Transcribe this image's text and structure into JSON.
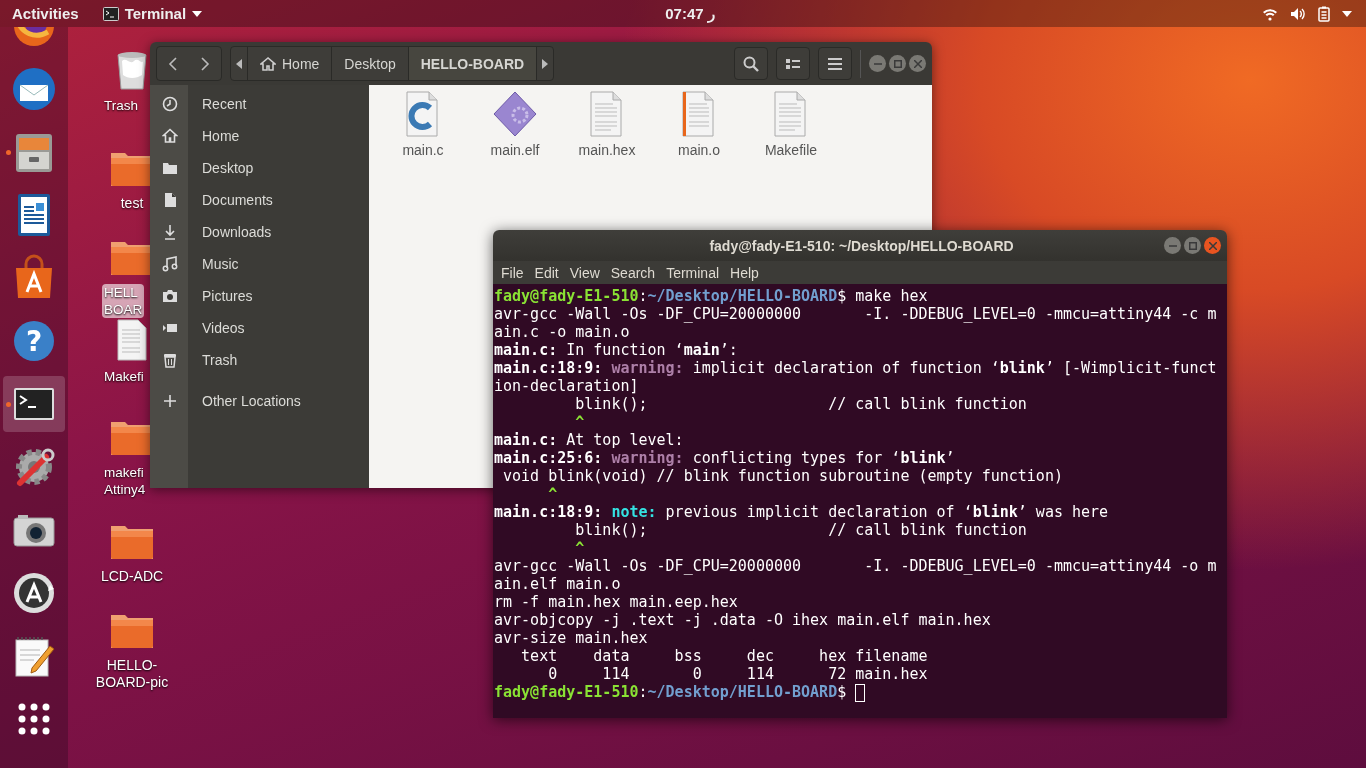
{
  "top_bar": {
    "activities": "Activities",
    "app_menu": "Terminal",
    "clock": "07:47 ر"
  },
  "dock": [
    {
      "kind": "globe",
      "running": false,
      "active": false
    },
    {
      "kind": "mail",
      "running": false,
      "active": false
    },
    {
      "kind": "files",
      "running": true,
      "active": false
    },
    {
      "kind": "writer",
      "running": false,
      "active": false
    },
    {
      "kind": "store",
      "running": false,
      "active": false
    },
    {
      "kind": "help",
      "glyph": "?",
      "running": false,
      "active": false
    },
    {
      "kind": "terminal",
      "running": true,
      "active": true
    },
    {
      "kind": "tools",
      "running": false,
      "active": false
    },
    {
      "kind": "camera",
      "running": false,
      "active": false
    },
    {
      "kind": "updater",
      "running": false,
      "active": false
    },
    {
      "kind": "editor",
      "running": false,
      "active": false
    },
    {
      "kind": "grid",
      "running": false,
      "active": false
    }
  ],
  "desktop_items": [
    {
      "kind": "trash",
      "label_lines": [
        "Trash"
      ],
      "cut": true,
      "selected": false
    },
    {
      "kind": "folder",
      "label_lines": [
        "test"
      ],
      "cut": false,
      "selected": false
    },
    {
      "kind": "folder",
      "label_lines": [
        "HELL",
        "BOAR"
      ],
      "cut": true,
      "selected": true
    },
    {
      "kind": "document",
      "label_lines": [
        "Makefi"
      ],
      "cut": true,
      "selected": false
    },
    {
      "kind": "folder",
      "label_lines": [
        "makefi",
        "Attiny4"
      ],
      "cut": true,
      "selected": false
    },
    {
      "kind": "folder",
      "label_lines": [
        "LCD-ADC"
      ],
      "cut": false,
      "selected": false
    },
    {
      "kind": "folder",
      "label_lines": [
        "HELLO-",
        "BOARD-pic"
      ],
      "cut": false,
      "selected": false
    }
  ],
  "file_manager": {
    "path": [
      {
        "label": "Home",
        "kind": "home",
        "selected": false
      },
      {
        "label": "Desktop",
        "kind": "plain",
        "selected": false
      },
      {
        "label": "HELLO-BOARD",
        "kind": "plain",
        "selected": true
      }
    ],
    "sidebar": [
      {
        "label": "Recent",
        "kind": "clock"
      },
      {
        "label": "Home",
        "kind": "home"
      },
      {
        "label": "Desktop",
        "kind": "folder"
      },
      {
        "label": "Documents",
        "kind": "document"
      },
      {
        "label": "Downloads",
        "kind": "download"
      },
      {
        "label": "Music",
        "kind": "music"
      },
      {
        "label": "Pictures",
        "kind": "camera"
      },
      {
        "label": "Videos",
        "kind": "video"
      },
      {
        "label": "Trash",
        "kind": "trash"
      },
      {
        "label": "Other Locations",
        "kind": "plus"
      }
    ],
    "files": [
      {
        "name": "main.c",
        "kind": "c-source"
      },
      {
        "name": "main.elf",
        "kind": "binary"
      },
      {
        "name": "main.hex",
        "kind": "text"
      },
      {
        "name": "main.o",
        "kind": "object"
      },
      {
        "name": "Makefile",
        "kind": "text"
      }
    ]
  },
  "terminal": {
    "title": "fady@fady-E1-510: ~/Desktop/HELLO-BOARD",
    "menu": [
      "File",
      "Edit",
      "View",
      "Search",
      "Terminal",
      "Help"
    ],
    "cursor": true,
    "lines": [
      [
        {
          "t": "fady@fady-E1-510",
          "kind": "user"
        },
        {
          "t": ":",
          "kind": "plain"
        },
        {
          "t": "~/Desktop/HELLO-BOARD",
          "kind": "path"
        },
        {
          "t": "$ make hex",
          "kind": "plain"
        }
      ],
      [
        {
          "t": "avr-gcc -Wall -Os -DF_CPU=20000000       -I. -DDEBUG_LEVEL=0 -mmcu=attiny44 -c m",
          "kind": "plain"
        }
      ],
      [
        {
          "t": "ain.c -o main.o",
          "kind": "plain"
        }
      ],
      [
        {
          "t": "main.c:",
          "kind": "bold"
        },
        {
          "t": " In function ‘",
          "kind": "plain"
        },
        {
          "t": "main",
          "kind": "bold"
        },
        {
          "t": "’:",
          "kind": "plain"
        }
      ],
      [
        {
          "t": "main.c:18:9: ",
          "kind": "bold"
        },
        {
          "t": "warning:",
          "kind": "warning"
        },
        {
          "t": " implicit declaration of function ‘",
          "kind": "plain"
        },
        {
          "t": "blink",
          "kind": "bold"
        },
        {
          "t": "’ [-Wimplicit-funct",
          "kind": "plain"
        }
      ],
      [
        {
          "t": "ion-declaration]",
          "kind": "plain"
        }
      ],
      [
        {
          "t": "         blink();                    // call blink function",
          "kind": "plain"
        }
      ],
      [
        {
          "t": "         ^",
          "kind": "caret"
        }
      ],
      [
        {
          "t": "main.c:",
          "kind": "bold"
        },
        {
          "t": " At top level:",
          "kind": "plain"
        }
      ],
      [
        {
          "t": "main.c:25:6: ",
          "kind": "bold"
        },
        {
          "t": "warning:",
          "kind": "warning"
        },
        {
          "t": " conflicting types for ‘",
          "kind": "plain"
        },
        {
          "t": "blink",
          "kind": "bold"
        },
        {
          "t": "’",
          "kind": "plain"
        }
      ],
      [
        {
          "t": " void blink(void) // blink function subroutine (empty function)",
          "kind": "plain"
        }
      ],
      [
        {
          "t": "      ^",
          "kind": "caret"
        }
      ],
      [
        {
          "t": "main.c:18:9: ",
          "kind": "bold"
        },
        {
          "t": "note:",
          "kind": "note"
        },
        {
          "t": " previous implicit declaration of ‘",
          "kind": "plain"
        },
        {
          "t": "blink",
          "kind": "bold"
        },
        {
          "t": "’ was here",
          "kind": "plain"
        }
      ],
      [
        {
          "t": "         blink();                    // call blink function",
          "kind": "plain"
        }
      ],
      [
        {
          "t": "         ^",
          "kind": "caret"
        }
      ],
      [
        {
          "t": "avr-gcc -Wall -Os -DF_CPU=20000000       -I. -DDEBUG_LEVEL=0 -mmcu=attiny44 -o m",
          "kind": "plain"
        }
      ],
      [
        {
          "t": "ain.elf main.o",
          "kind": "plain"
        }
      ],
      [
        {
          "t": "rm -f main.hex main.eep.hex",
          "kind": "plain"
        }
      ],
      [
        {
          "t": "avr-objcopy -j .text -j .data -O ihex main.elf main.hex",
          "kind": "plain"
        }
      ],
      [
        {
          "t": "avr-size main.hex",
          "kind": "plain"
        }
      ],
      [
        {
          "t": "   text    data     bss     dec     hex filename",
          "kind": "plain"
        }
      ],
      [
        {
          "t": "      0     114       0     114      72 main.hex",
          "kind": "plain"
        }
      ],
      [
        {
          "t": "fady@fady-E1-510",
          "kind": "user"
        },
        {
          "t": ":",
          "kind": "plain"
        },
        {
          "t": "~/Desktop/HELLO-BOARD",
          "kind": "path"
        },
        {
          "t": "$",
          "kind": "plain"
        }
      ]
    ]
  }
}
